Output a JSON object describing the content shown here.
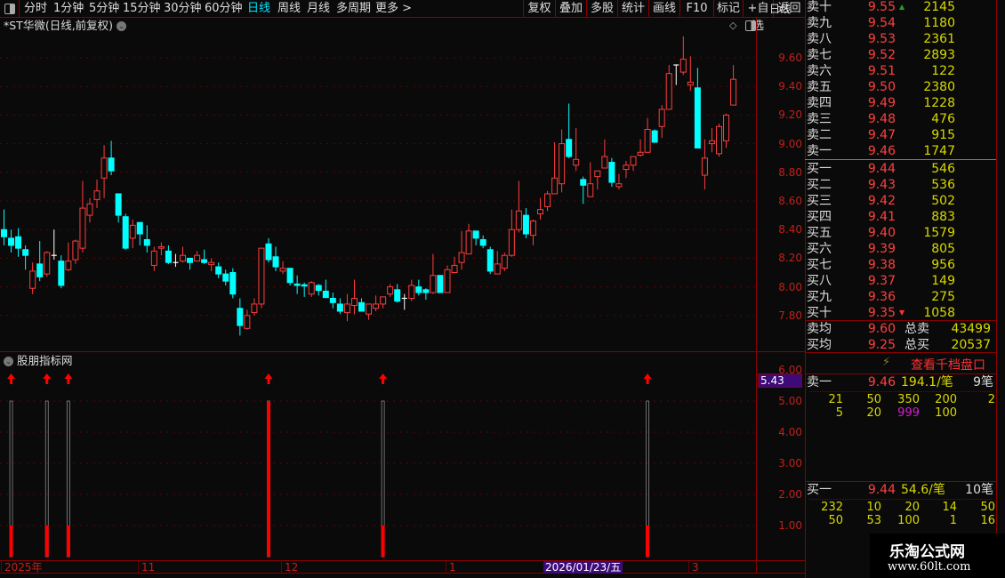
{
  "toolbar": {
    "periods": [
      "分时",
      "1分钟",
      "5分钟",
      "15分钟",
      "30分钟",
      "60分钟",
      "日线",
      "周线",
      "月线",
      "多周期",
      "更多 >"
    ],
    "active_period": "日线",
    "buttons": [
      "复权",
      "叠加",
      "多股",
      "统计",
      "画线",
      "F10",
      "标记",
      "+自选",
      "返回"
    ]
  },
  "chart_title": "*ST华微(日线,前复权)",
  "price_axis": [
    "9.60",
    "9.40",
    "9.20",
    "9.00",
    "8.80",
    "8.60",
    "8.40",
    "8.20",
    "8.00",
    "7.80"
  ],
  "indicator": {
    "title": "股朋指标网",
    "axis": [
      "6.00",
      "5.00",
      "4.00",
      "3.00",
      "2.00",
      "1.00"
    ],
    "current_value": "5.43",
    "signals": [
      {
        "candle": 1,
        "outline": 5,
        "fill": 1
      },
      {
        "candle": 6,
        "outline": 5,
        "fill": 1
      },
      {
        "candle": 9,
        "outline": 5,
        "fill": 1
      },
      {
        "candle": 37,
        "outline": 5,
        "fill": 5
      },
      {
        "candle": 53,
        "outline": 5,
        "fill": 1
      },
      {
        "candle": 90,
        "outline": 5,
        "fill": 1
      }
    ]
  },
  "time_axis": {
    "labels": [
      "2025年",
      "11",
      "12",
      "1",
      "3"
    ],
    "highlight": "2026/01/23/五",
    "period": "日线"
  },
  "colors": {
    "up": "#ff3c3c",
    "down": "#00ffff",
    "doji": "#ffffff",
    "grid": "#8b0000",
    "highlight": "#3d0a7a"
  },
  "chart_data": {
    "type": "candlestick",
    "ylim": [
      7.6,
      9.8
    ],
    "fields": [
      "open",
      "high",
      "low",
      "close"
    ],
    "candles": [
      [
        8.4,
        8.54,
        8.29,
        8.35
      ],
      [
        8.34,
        8.4,
        8.24,
        8.29
      ],
      [
        8.35,
        8.41,
        8.21,
        8.27
      ],
      [
        8.26,
        8.29,
        8.12,
        8.22
      ],
      [
        7.99,
        8.17,
        7.95,
        8.11
      ],
      [
        8.16,
        8.32,
        8.04,
        8.07
      ],
      [
        8.09,
        8.25,
        8.07,
        8.24
      ],
      [
        8.22,
        8.4,
        8.19,
        8.22
      ],
      [
        8.18,
        8.22,
        7.99,
        8.01
      ],
      [
        8.12,
        8.31,
        8.11,
        8.18
      ],
      [
        8.19,
        8.33,
        8.16,
        8.32
      ],
      [
        8.27,
        8.74,
        8.24,
        8.55
      ],
      [
        8.5,
        8.62,
        8.45,
        8.58
      ],
      [
        8.61,
        8.75,
        8.55,
        8.67
      ],
      [
        8.76,
        8.99,
        8.62,
        8.9
      ],
      [
        8.9,
        9.02,
        8.78,
        8.81
      ],
      [
        8.65,
        8.65,
        8.45,
        8.5
      ],
      [
        8.49,
        8.51,
        8.26,
        8.27
      ],
      [
        8.34,
        8.47,
        8.27,
        8.43
      ],
      [
        8.45,
        8.45,
        8.29,
        8.37
      ],
      [
        8.33,
        8.43,
        8.24,
        8.29
      ],
      [
        8.15,
        8.28,
        8.11,
        8.25
      ],
      [
        8.27,
        8.31,
        8.22,
        8.28
      ],
      [
        8.25,
        8.29,
        8.16,
        8.17
      ],
      [
        8.17,
        8.23,
        8.14,
        8.17
      ],
      [
        8.18,
        8.28,
        8.17,
        8.22
      ],
      [
        8.2,
        8.2,
        8.12,
        8.17
      ],
      [
        8.18,
        8.25,
        8.18,
        8.22
      ],
      [
        8.19,
        8.26,
        8.16,
        8.17
      ],
      [
        8.155,
        8.2,
        8.11,
        8.17
      ],
      [
        8.14,
        8.17,
        8.06,
        8.09
      ],
      [
        8.09,
        8.12,
        8.01,
        8.04
      ],
      [
        8.1,
        8.13,
        7.92,
        7.95
      ],
      [
        7.85,
        7.92,
        7.66,
        7.73
      ],
      [
        7.71,
        7.84,
        7.7,
        7.8
      ],
      [
        7.82,
        7.92,
        7.8,
        7.88
      ],
      [
        7.88,
        8.27,
        7.85,
        8.27
      ],
      [
        8.3,
        8.34,
        8.17,
        8.19
      ],
      [
        8.21,
        8.28,
        8.11,
        8.14
      ],
      [
        8.11,
        8.18,
        8.09,
        8.13
      ],
      [
        8.13,
        8.13,
        8.01,
        8.03
      ],
      [
        8.02,
        8.08,
        7.95,
        8.01
      ],
      [
        8.015,
        8.03,
        7.93,
        8.01
      ],
      [
        7.95,
        8.04,
        7.93,
        8.03
      ],
      [
        8.01,
        8.02,
        7.94,
        7.975
      ],
      [
        7.97,
        8.05,
        7.925,
        7.925
      ],
      [
        7.92,
        7.96,
        7.85,
        7.89
      ],
      [
        7.88,
        7.92,
        7.81,
        7.83
      ],
      [
        7.82,
        7.95,
        7.76,
        7.88
      ],
      [
        7.87,
        8.05,
        7.81,
        7.92
      ],
      [
        7.89,
        7.92,
        7.83,
        7.83
      ],
      [
        7.81,
        7.88,
        7.77,
        7.88
      ],
      [
        7.85,
        7.94,
        7.83,
        7.88
      ],
      [
        7.88,
        7.93,
        7.85,
        7.93
      ],
      [
        7.95,
        8.02,
        7.93,
        8.0
      ],
      [
        7.98,
        8.02,
        7.89,
        7.9
      ],
      [
        7.92,
        7.95,
        7.84,
        7.92
      ],
      [
        7.92,
        8.05,
        7.9,
        8.01
      ],
      [
        8.0,
        8.05,
        7.94,
        7.96
      ],
      [
        7.98,
        7.99,
        7.91,
        7.96
      ],
      [
        7.96,
        8.23,
        7.95,
        8.08
      ],
      [
        8.08,
        8.08,
        7.96,
        7.96
      ],
      [
        7.96,
        8.15,
        7.96,
        8.12
      ],
      [
        8.1,
        8.21,
        8.1,
        8.15
      ],
      [
        8.17,
        8.39,
        8.12,
        8.24
      ],
      [
        8.23,
        8.44,
        8.23,
        8.39
      ],
      [
        8.39,
        8.39,
        8.29,
        8.34
      ],
      [
        8.33,
        8.36,
        8.27,
        8.29
      ],
      [
        8.26,
        8.28,
        8.09,
        8.11
      ],
      [
        8.09,
        8.25,
        8.09,
        8.16
      ],
      [
        8.13,
        8.24,
        8.11,
        8.22
      ],
      [
        8.22,
        8.54,
        8.21,
        8.4
      ],
      [
        8.4,
        8.74,
        8.38,
        8.53
      ],
      [
        8.5,
        8.55,
        8.34,
        8.37
      ],
      [
        8.36,
        8.47,
        8.29,
        8.46
      ],
      [
        8.51,
        8.62,
        8.47,
        8.54
      ],
      [
        8.56,
        8.67,
        8.53,
        8.65
      ],
      [
        8.65,
        9.01,
        8.65,
        8.76
      ],
      [
        8.72,
        9.1,
        8.66,
        9.0
      ],
      [
        9.03,
        9.28,
        8.9,
        8.91
      ],
      [
        8.85,
        9.11,
        8.81,
        8.89
      ],
      [
        8.75,
        8.77,
        8.58,
        8.71
      ],
      [
        8.63,
        8.87,
        8.63,
        8.72
      ],
      [
        8.77,
        8.81,
        8.68,
        8.81
      ],
      [
        8.83,
        9.03,
        8.83,
        8.91
      ],
      [
        8.87,
        8.9,
        8.7,
        8.73
      ],
      [
        8.7,
        8.79,
        8.68,
        8.72
      ],
      [
        8.82,
        8.88,
        8.76,
        8.85
      ],
      [
        8.85,
        8.91,
        8.81,
        8.91
      ],
      [
        8.92,
        9.03,
        8.91,
        8.94
      ],
      [
        8.94,
        9.18,
        8.94,
        9.1
      ],
      [
        9.09,
        9.1,
        9.01,
        9.01
      ],
      [
        9.12,
        9.27,
        9.04,
        9.24
      ],
      [
        9.24,
        9.55,
        9.24,
        9.49
      ],
      [
        9.55,
        9.55,
        9.41,
        9.55
      ],
      [
        9.5,
        9.75,
        9.48,
        9.59
      ],
      [
        9.41,
        9.61,
        9.37,
        9.43
      ],
      [
        9.39,
        9.53,
        8.97,
        8.97
      ],
      [
        8.78,
        9.03,
        8.68,
        8.9
      ],
      [
        9.0,
        9.11,
        8.94,
        9.02
      ],
      [
        8.93,
        9.14,
        8.91,
        9.12
      ],
      [
        9.02,
        9.21,
        8.97,
        9.2
      ],
      [
        9.27,
        9.55,
        9.27,
        9.45
      ]
    ]
  },
  "order_book": {
    "sells": [
      {
        "label": "卖十",
        "price": "9.55",
        "volume": "2145",
        "marker": "▲"
      },
      {
        "label": "卖九",
        "price": "9.54",
        "volume": "1180"
      },
      {
        "label": "卖八",
        "price": "9.53",
        "volume": "2361"
      },
      {
        "label": "卖七",
        "price": "9.52",
        "volume": "2893"
      },
      {
        "label": "卖六",
        "price": "9.51",
        "volume": "122"
      },
      {
        "label": "卖五",
        "price": "9.50",
        "volume": "2380"
      },
      {
        "label": "卖四",
        "price": "9.49",
        "volume": "1228"
      },
      {
        "label": "卖三",
        "price": "9.48",
        "volume": "476"
      },
      {
        "label": "卖二",
        "price": "9.47",
        "volume": "915"
      },
      {
        "label": "卖一",
        "price": "9.46",
        "volume": "1747"
      }
    ],
    "buys": [
      {
        "label": "买一",
        "price": "9.44",
        "volume": "546"
      },
      {
        "label": "买二",
        "price": "9.43",
        "volume": "536"
      },
      {
        "label": "买三",
        "price": "9.42",
        "volume": "502"
      },
      {
        "label": "买四",
        "price": "9.41",
        "volume": "883"
      },
      {
        "label": "买五",
        "price": "9.40",
        "volume": "1579"
      },
      {
        "label": "买六",
        "price": "9.39",
        "volume": "805"
      },
      {
        "label": "买七",
        "price": "9.38",
        "volume": "956"
      },
      {
        "label": "买八",
        "price": "9.37",
        "volume": "149"
      },
      {
        "label": "买九",
        "price": "9.36",
        "volume": "275"
      },
      {
        "label": "买十",
        "price": "9.35",
        "volume": "1058",
        "marker": "▼"
      }
    ],
    "summary": [
      {
        "label": "卖均",
        "price": "9.60",
        "total_label": "总卖",
        "total": "43499"
      },
      {
        "label": "买均",
        "price": "9.25",
        "total_label": "总买",
        "total": "20537"
      }
    ],
    "thousand_levels_link": "查看千档盘口"
  },
  "queue": {
    "sell": {
      "label": "卖一",
      "price": "9.46",
      "avg": "194.1/笔",
      "count": "9笔",
      "orders": [
        [
          "21",
          "50",
          "350",
          "200",
          "2"
        ],
        [
          "5",
          "20",
          "999",
          "100",
          ""
        ]
      ],
      "highlight": "999"
    },
    "buy": {
      "label": "买一",
      "price": "9.44",
      "avg": "54.6/笔",
      "count": "10笔",
      "orders": [
        [
          "232",
          "10",
          "20",
          "14",
          "50"
        ],
        [
          "50",
          "53",
          "100",
          "1",
          "16"
        ]
      ]
    }
  },
  "watermark": {
    "name": "乐淘公式网",
    "url": "www.60lt.com"
  }
}
